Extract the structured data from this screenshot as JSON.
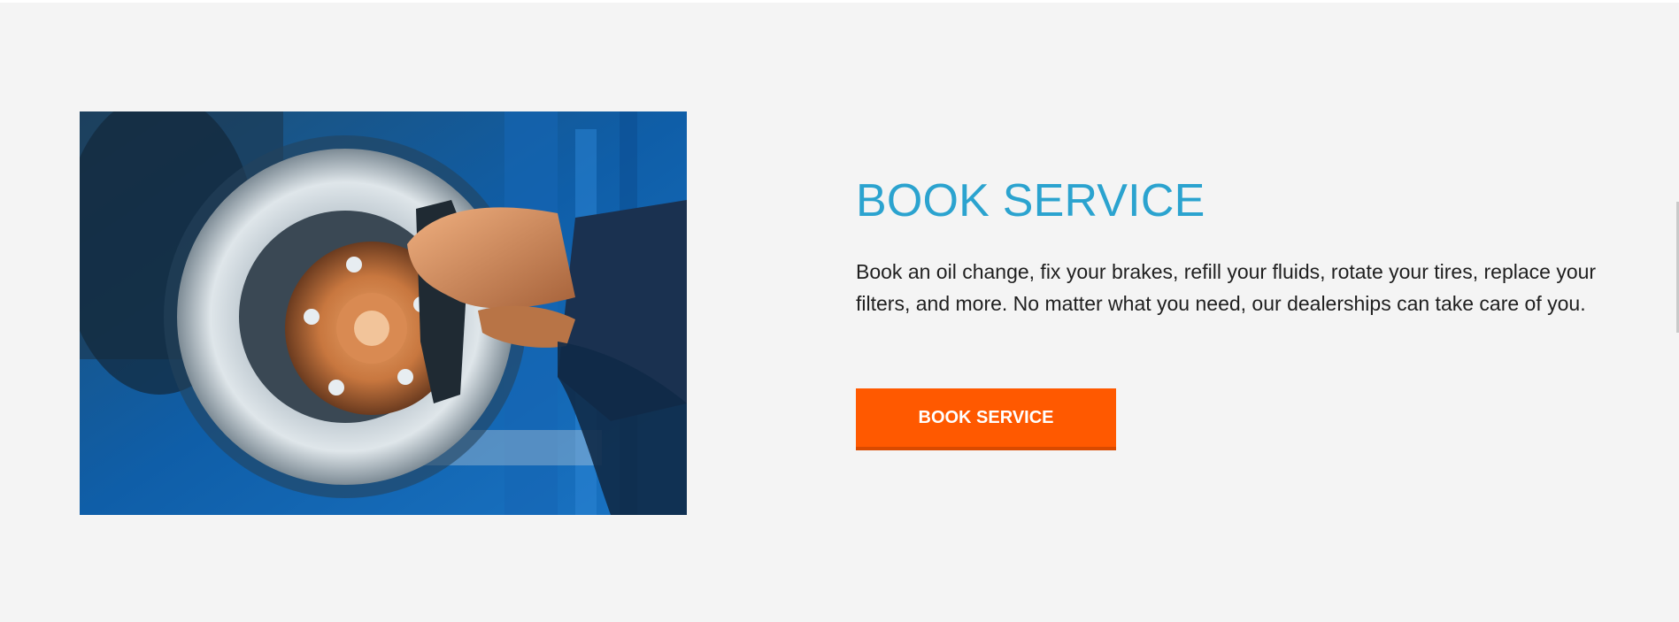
{
  "section": {
    "heading": "BOOK SERVICE",
    "description": "Book an oil change, fix your brakes, refill your fluids, rotate your tires, replace your filters, and more. No matter what you need, our dealerships can take care of you.",
    "cta_label": "BOOK SERVICE",
    "image_subject": "mechanic-servicing-brake-disc"
  },
  "colors": {
    "background": "#f4f4f4",
    "heading": "#2ba3cf",
    "body_text": "#1f1f1f",
    "button": "#ff5900",
    "button_text": "#ffffff"
  }
}
